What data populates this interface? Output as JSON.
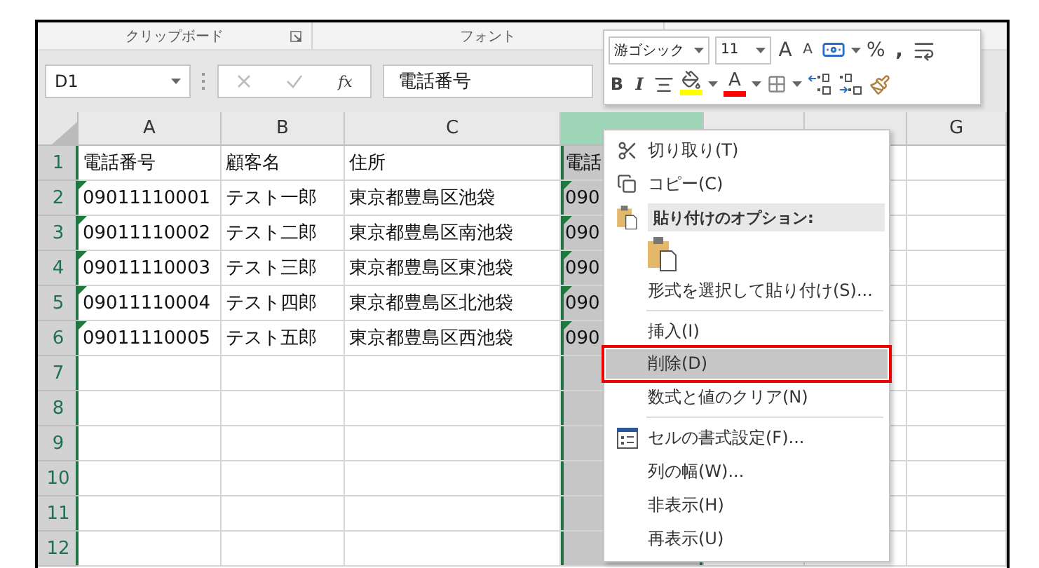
{
  "ribbon_groups": [
    {
      "label": "クリップボード"
    },
    {
      "label": "フォント"
    }
  ],
  "name_box": {
    "value": "D1"
  },
  "formula_bar": {
    "label": "fx",
    "value": "電話番号"
  },
  "columns": [
    {
      "label": "A",
      "selected": false
    },
    {
      "label": "B",
      "selected": false
    },
    {
      "label": "C",
      "selected": false
    },
    {
      "selected": true
    },
    {
      "selected": false
    },
    {
      "selected": false
    },
    {
      "label": "G",
      "selected": false
    }
  ],
  "rows": [
    {
      "label": "1",
      "selected": true,
      "cells": [
        {
          "text": "電話番号",
          "flagged": false
        },
        {
          "text": "顧客名",
          "flagged": false
        },
        {
          "text": "住所",
          "flagged": false
        },
        {
          "text": "電話",
          "flagged": false
        }
      ]
    },
    {
      "label": "2",
      "selected": true,
      "cells": [
        {
          "text": "09011110001",
          "flagged": true
        },
        {
          "text": "テスト一郎",
          "flagged": false
        },
        {
          "text": "東京都豊島区池袋",
          "flagged": false
        },
        {
          "text": "090",
          "flagged": true
        }
      ]
    },
    {
      "label": "3",
      "selected": true,
      "cells": [
        {
          "text": "09011110002",
          "flagged": true
        },
        {
          "text": "テスト二郎",
          "flagged": false
        },
        {
          "text": "東京都豊島区南池袋",
          "flagged": false
        },
        {
          "text": "090",
          "flagged": true
        }
      ]
    },
    {
      "label": "4",
      "selected": true,
      "cells": [
        {
          "text": "09011110003",
          "flagged": true
        },
        {
          "text": "テスト三郎",
          "flagged": false
        },
        {
          "text": "東京都豊島区東池袋",
          "flagged": false
        },
        {
          "text": "090",
          "flagged": true
        }
      ]
    },
    {
      "label": "5",
      "selected": true,
      "cells": [
        {
          "text": "09011110004",
          "flagged": true
        },
        {
          "text": "テスト四郎",
          "flagged": false
        },
        {
          "text": "東京都豊島区北池袋",
          "flagged": false
        },
        {
          "text": "090",
          "flagged": true
        }
      ]
    },
    {
      "label": "6",
      "selected": true,
      "cells": [
        {
          "text": "09011110005",
          "flagged": true
        },
        {
          "text": "テスト五郎",
          "flagged": false
        },
        {
          "text": "東京都豊島区西池袋",
          "flagged": false
        },
        {
          "text": "090",
          "flagged": true
        }
      ]
    },
    {
      "label": "7",
      "selected": true,
      "cells": []
    },
    {
      "label": "8",
      "selected": true,
      "cells": []
    },
    {
      "label": "9",
      "selected": true,
      "cells": []
    },
    {
      "label": "10",
      "selected": true,
      "cells": []
    },
    {
      "label": "11",
      "selected": true,
      "cells": []
    },
    {
      "label": "12",
      "selected": true,
      "cells": []
    }
  ],
  "mini_toolbar": {
    "font": "游ゴシック",
    "size": "11",
    "grow": "A",
    "shrink": "A",
    "percent": "%",
    "comma": ",",
    "bold": "B",
    "italic": "I",
    "font_color_letter": "A"
  },
  "context_menu": [
    {
      "kind": "item",
      "label": "切り取り(T)",
      "selected": false
    },
    {
      "kind": "item",
      "label": "コピー(C)",
      "selected": false
    },
    {
      "kind": "heading",
      "label": "貼り付けのオプション:",
      "selected": false
    },
    {
      "kind": "paste_options",
      "selected": false
    },
    {
      "kind": "item",
      "label": "形式を選択して貼り付け(S)...",
      "selected": false
    },
    {
      "kind": "separator"
    },
    {
      "kind": "item",
      "label": "挿入(I)",
      "selected": false
    },
    {
      "kind": "item",
      "label": "削除(D)",
      "selected": true
    },
    {
      "kind": "item",
      "label": "数式と値のクリア(N)",
      "selected": false
    },
    {
      "kind": "separator"
    },
    {
      "kind": "item",
      "label": "セルの書式設定(F)...",
      "selected": false
    },
    {
      "kind": "item",
      "label": "列の幅(W)...",
      "selected": false
    },
    {
      "kind": "item",
      "label": "非表示(H)",
      "selected": false
    },
    {
      "kind": "item",
      "label": "再表示(U)",
      "selected": false
    }
  ]
}
